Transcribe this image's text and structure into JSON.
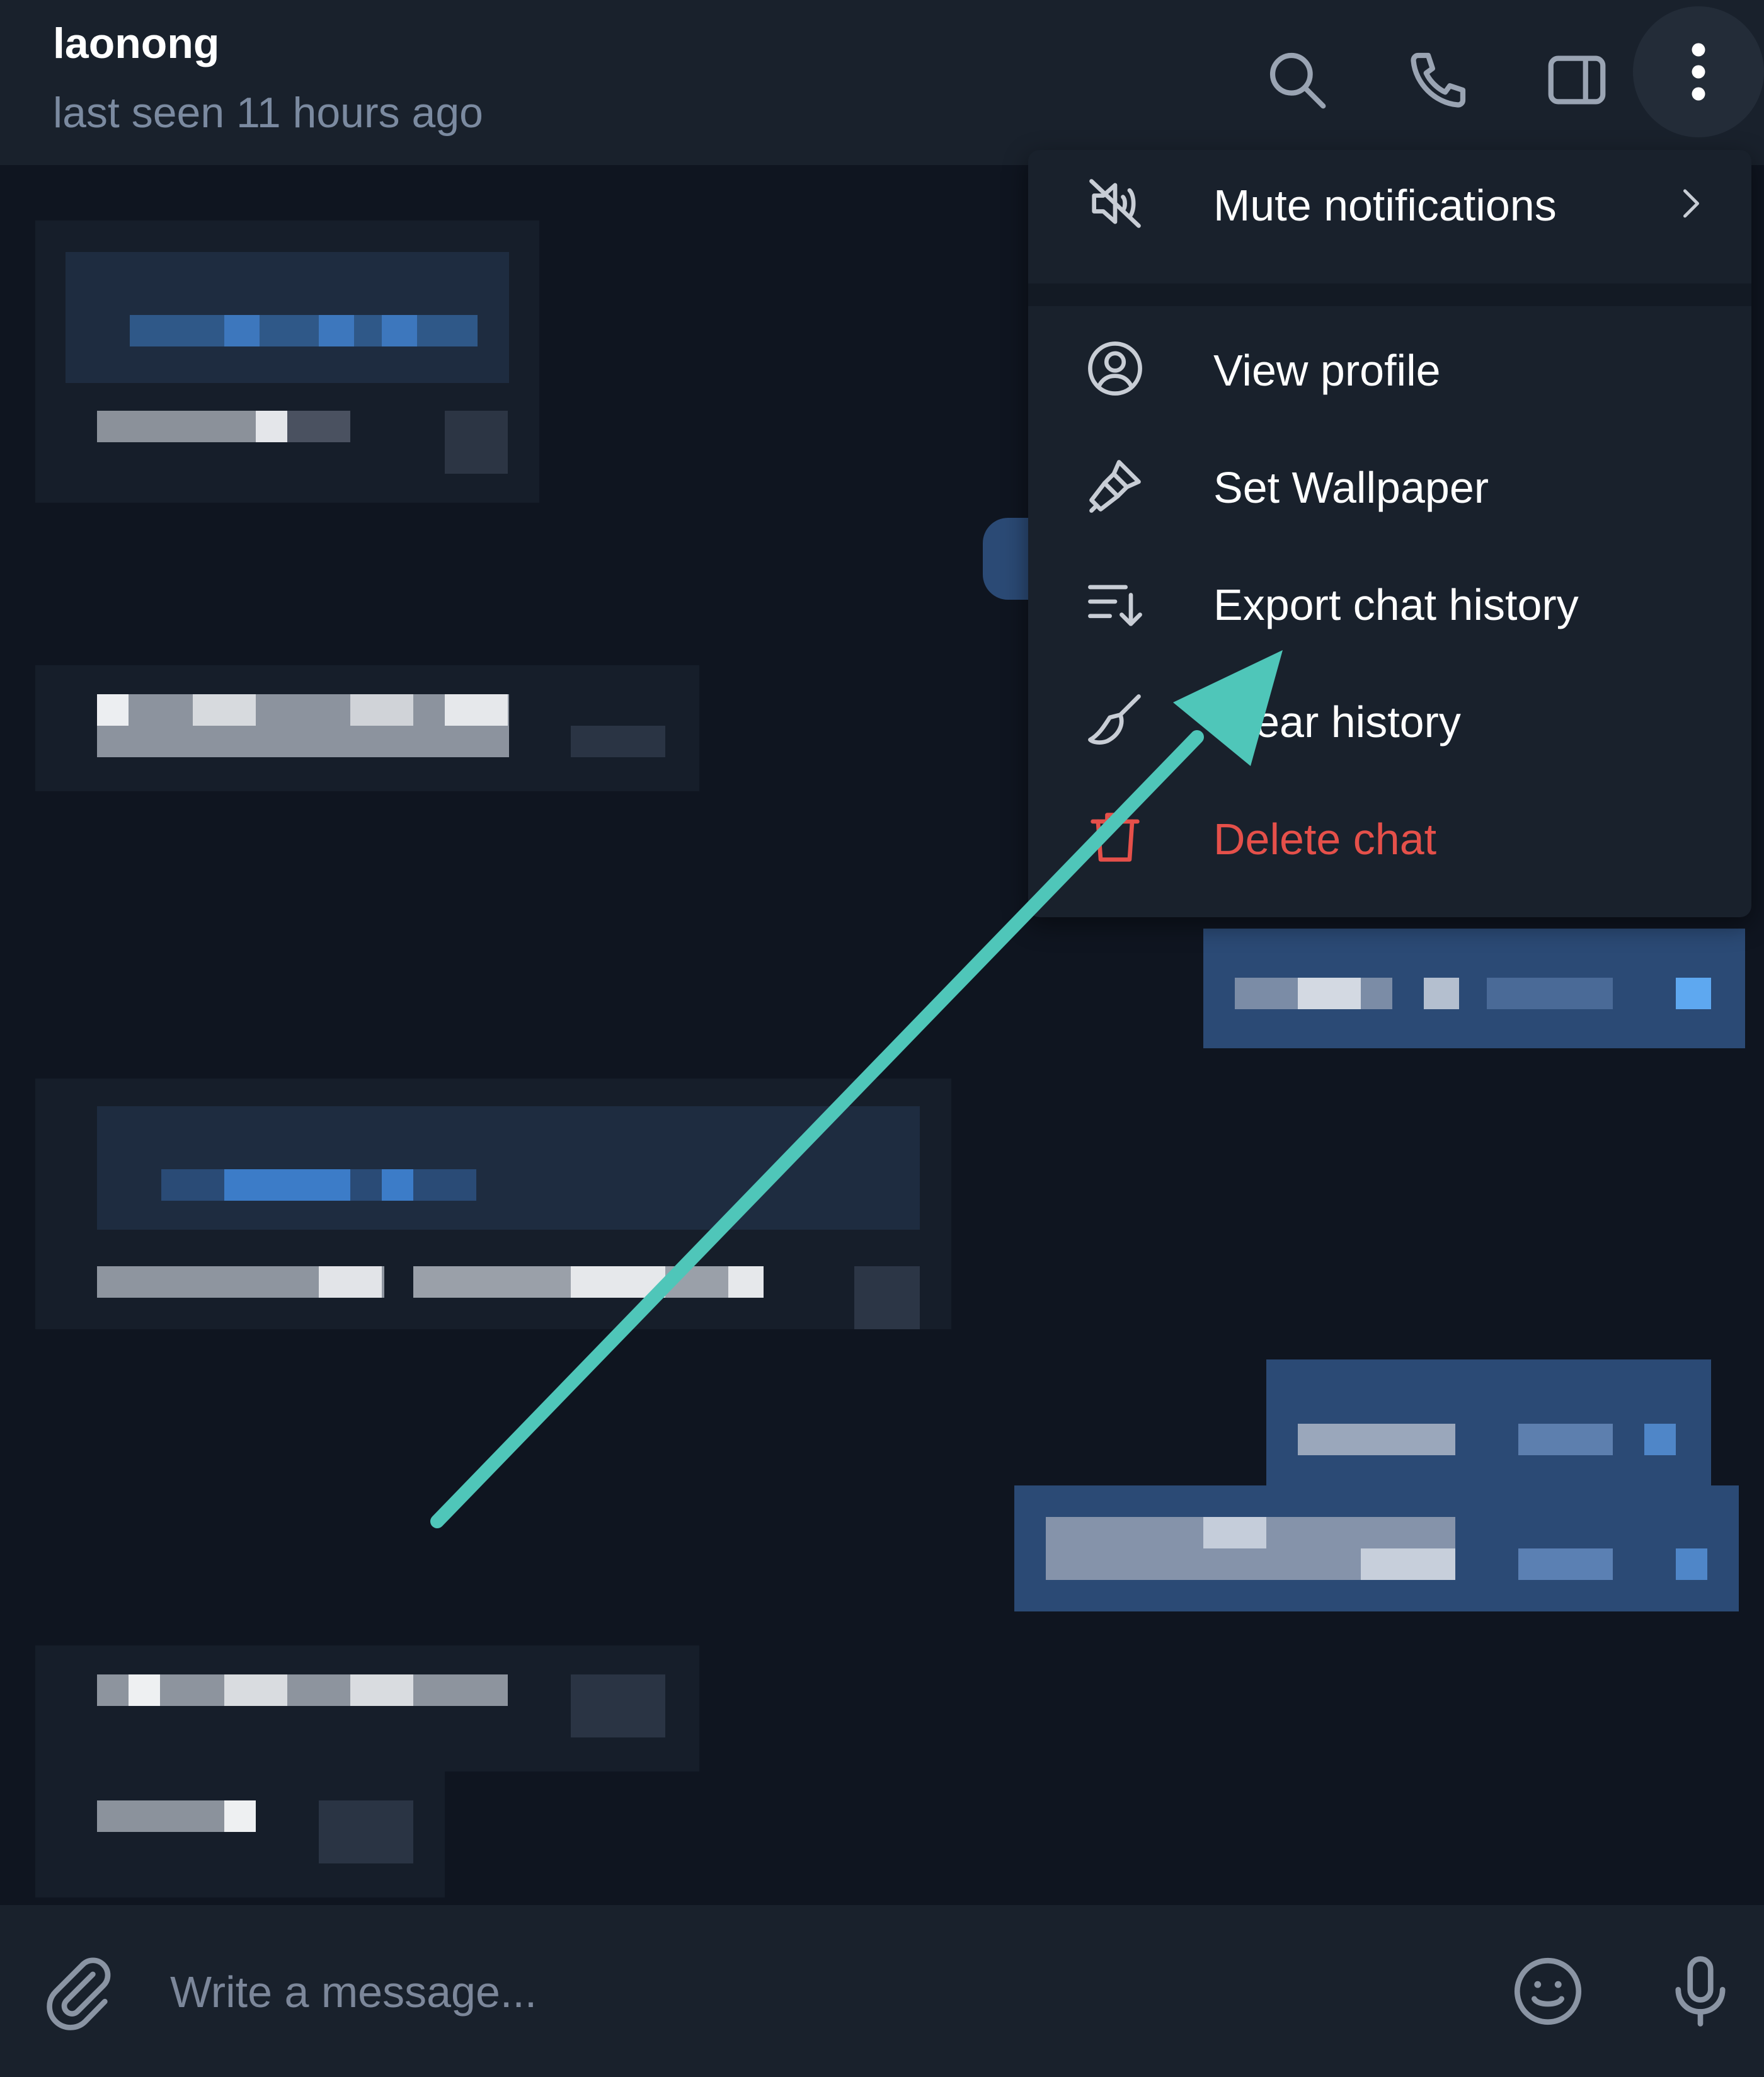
{
  "header": {
    "name": "laonong",
    "status": "last seen 11 hours ago",
    "icons": [
      "search-icon",
      "phone-icon",
      "sidebar-toggle-icon",
      "more-vertical-icon"
    ]
  },
  "menu": {
    "items": [
      {
        "label": "Mute notifications",
        "icon": "mute-icon",
        "has_submenu": true
      },
      {
        "label": "View profile",
        "icon": "profile-icon"
      },
      {
        "label": "Set Wallpaper",
        "icon": "brush-icon"
      },
      {
        "label": "Export chat history",
        "icon": "export-icon"
      },
      {
        "label": "Clear history",
        "icon": "broom-icon"
      },
      {
        "label": "Delete chat",
        "icon": "trash-icon",
        "color": "#e5504a"
      }
    ]
  },
  "composer": {
    "placeholder": "Write a message...",
    "icons": [
      "attach-icon",
      "emoji-icon",
      "microphone-icon"
    ]
  },
  "annotation": {
    "arrow_color": "#4fc6b9"
  },
  "colors": {
    "background": "#0f1520",
    "panel": "#19212c",
    "outgoing_bubble": "#2b4a75",
    "danger": "#e5504a",
    "accent": "#4fc6b9"
  }
}
